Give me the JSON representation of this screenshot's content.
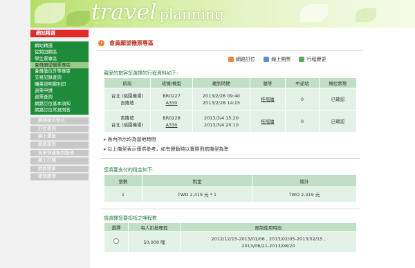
{
  "banner": {
    "word1": "travel",
    "word2": "planning"
  },
  "sidebar": {
    "header": "網站精選",
    "items": [
      "網站精選",
      "促銷回饋區",
      "學生票專區",
      "會員願望機票專區",
      "會員艙位升等專區",
      "交易記錄查詢",
      "購票證明單列印",
      "退票申請",
      "退票查詢",
      "網路訂位基本須知",
      "網路訂位常見問答"
    ],
    "gray_items": [
      "網路艙位熱位",
      "訂位查詢",
      "網上選艙",
      "網路報到",
      "長榮快速報到服務",
      "線上訂購",
      "網路租車",
      "服務服務"
    ]
  },
  "page": {
    "title": "會員願望機票專區",
    "actions": [
      {
        "label": "網路訂位",
        "icon": "booking-icon"
      },
      {
        "label": "線上開票",
        "icon": "ticketing-icon"
      },
      {
        "label": "行程變更",
        "icon": "change-itinerary-icon"
      }
    ]
  },
  "itinerary": {
    "caption": "親愛的旅客您選擇的行程資料如下:",
    "headers": [
      "航段",
      "班機/機型",
      "離到時間",
      "艙等",
      "中途站",
      "機位狀態"
    ],
    "rows": [
      {
        "from": "台北 (桃園機場)",
        "to": "吉隆坡",
        "flight": "BR0227",
        "aircraft": "A330",
        "dep": "2013/2/28 09:40",
        "arr": "2013/2/28 14:15",
        "cabin": "桂冠艙",
        "stops": "0",
        "status": "已確認"
      },
      {
        "from": "吉隆坡",
        "to": "台北 (桃園機場)",
        "flight": "BR0228",
        "aircraft": "A330",
        "dep": "2013/3/4 15:20",
        "arr": "2013/3/4 20:10",
        "cabin": "桂冠艙",
        "stops": "0",
        "status": "已確認"
      }
    ],
    "notes": [
      "表內所示均為當地時間",
      "以上機型表示僅供參考，如有變動時以實際飛航機型為準"
    ]
  },
  "taxes": {
    "caption": "您將要支付的稅金如下:",
    "headers": [
      "張數",
      "稅金",
      "總計"
    ],
    "row": {
      "count": "1",
      "tax": "TWD 2,419 元 * 1",
      "total": "TWD 2,419 元"
    }
  },
  "miles": {
    "caption": "請選擇您要扣抵之哩程數",
    "headers": [
      "選擇",
      "每人扣抵哩程",
      "限制使用時段"
    ],
    "row": {
      "miles": "50,000 哩",
      "periods_line1": "2012/12/15-2013/01/06 , 2013/02/05-2013/02/15 ,",
      "periods_line2": "2013/06/21-2013/08/20"
    }
  },
  "colors": {
    "accent_red": "#e12b2b",
    "nav_green": "#1e8b3a",
    "table_header": "#bfe0c5",
    "table_cell": "#e3f2e6"
  }
}
